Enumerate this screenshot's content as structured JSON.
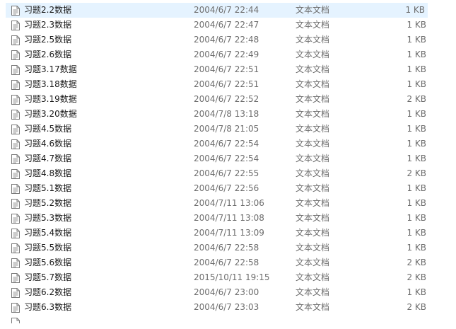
{
  "files": [
    {
      "name": "习题2.2数据",
      "modified": "2004/6/7 22:44",
      "type": "文本文档",
      "size": "1 KB"
    },
    {
      "name": "习题2.3数据",
      "modified": "2004/6/7 22:47",
      "type": "文本文档",
      "size": "1 KB"
    },
    {
      "name": "习题2.5数据",
      "modified": "2004/6/7 22:48",
      "type": "文本文档",
      "size": "1 KB"
    },
    {
      "name": "习题2.6数据",
      "modified": "2004/6/7 22:49",
      "type": "文本文档",
      "size": "1 KB"
    },
    {
      "name": "习题3.17数据",
      "modified": "2004/6/7 22:51",
      "type": "文本文档",
      "size": "1 KB"
    },
    {
      "name": "习题3.18数据",
      "modified": "2004/6/7 22:51",
      "type": "文本文档",
      "size": "1 KB"
    },
    {
      "name": "习题3.19数据",
      "modified": "2004/6/7 22:52",
      "type": "文本文档",
      "size": "2 KB"
    },
    {
      "name": "习题3.20数据",
      "modified": "2004/7/8 13:18",
      "type": "文本文档",
      "size": "1 KB"
    },
    {
      "name": "习题4.5数据",
      "modified": "2004/7/8 21:05",
      "type": "文本文档",
      "size": "1 KB"
    },
    {
      "name": "习题4.6数据",
      "modified": "2004/6/7 22:54",
      "type": "文本文档",
      "size": "1 KB"
    },
    {
      "name": "习题4.7数据",
      "modified": "2004/6/7 22:54",
      "type": "文本文档",
      "size": "1 KB"
    },
    {
      "name": "习题4.8数据",
      "modified": "2004/6/7 22:55",
      "type": "文本文档",
      "size": "2 KB"
    },
    {
      "name": "习题5.1数据",
      "modified": "2004/6/7 22:56",
      "type": "文本文档",
      "size": "1 KB"
    },
    {
      "name": "习题5.2数据",
      "modified": "2004/7/11 13:06",
      "type": "文本文档",
      "size": "1 KB"
    },
    {
      "name": "习题5.3数据",
      "modified": "2004/7/11 13:08",
      "type": "文本文档",
      "size": "1 KB"
    },
    {
      "name": "习题5.4数据",
      "modified": "2004/7/11 13:09",
      "type": "文本文档",
      "size": "1 KB"
    },
    {
      "name": "习题5.5数据",
      "modified": "2004/6/7 22:58",
      "type": "文本文档",
      "size": "1 KB"
    },
    {
      "name": "习题5.6数据",
      "modified": "2004/6/7 22:58",
      "type": "文本文档",
      "size": "2 KB"
    },
    {
      "name": "习题5.7数据",
      "modified": "2015/10/11 19:15",
      "type": "文本文档",
      "size": "2 KB"
    },
    {
      "name": "习题6.2数据",
      "modified": "2004/6/7 23:00",
      "type": "文本文档",
      "size": "1 KB"
    },
    {
      "name": "习题6.3数据",
      "modified": "2004/6/7 23:03",
      "type": "文本文档",
      "size": "2 KB"
    }
  ]
}
